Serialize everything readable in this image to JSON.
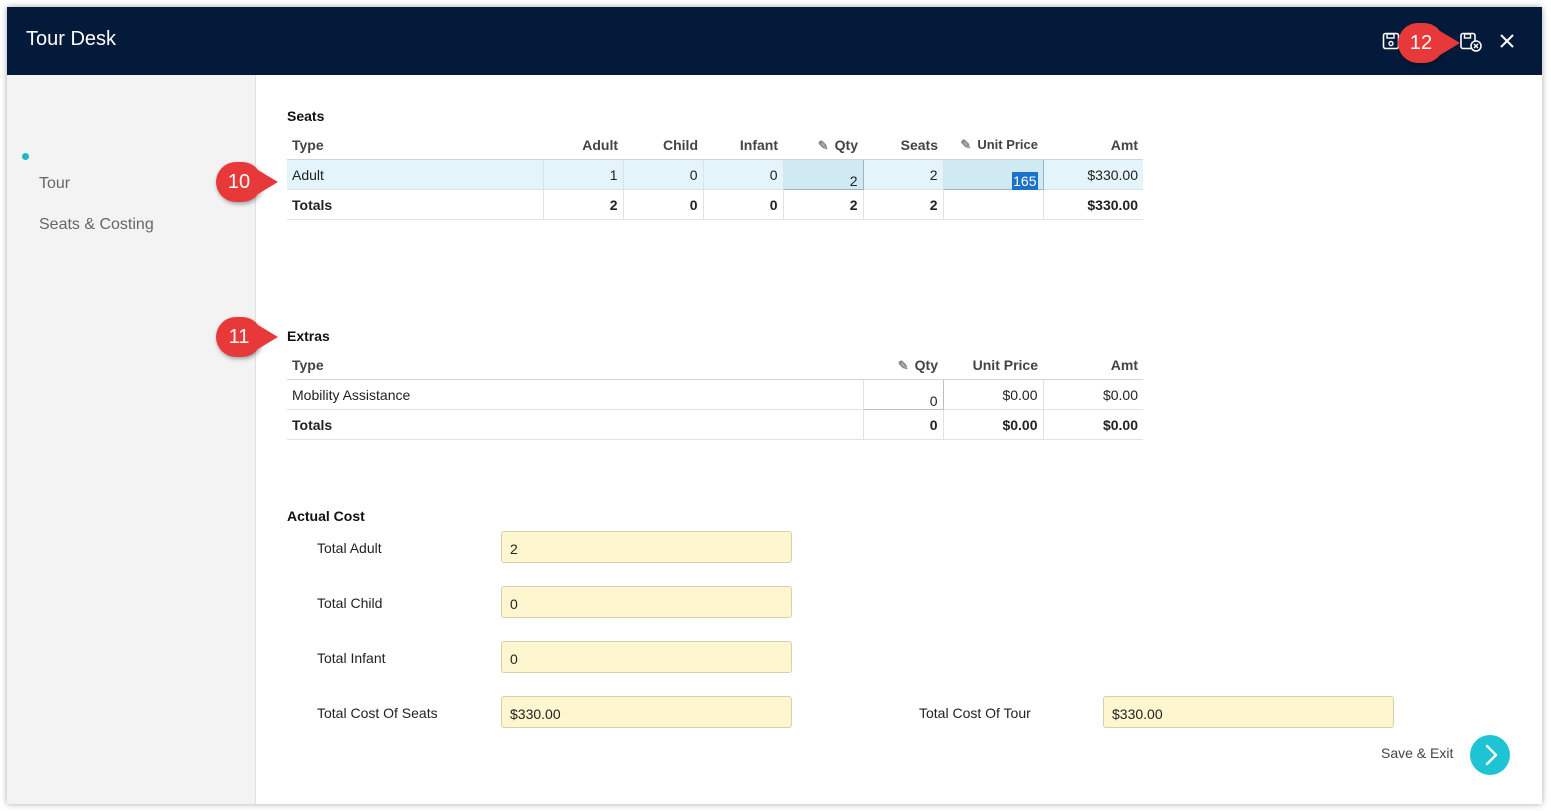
{
  "window": {
    "title": "Tour Desk"
  },
  "sidebar": {
    "items": [
      {
        "label": "Tour"
      },
      {
        "label": "Seats & Costing"
      }
    ]
  },
  "seats": {
    "title": "Seats",
    "columns": [
      "Type",
      "Adult",
      "Child",
      "Infant",
      "Qty",
      "Seats",
      "Unit Price",
      "Amt"
    ],
    "rows": [
      {
        "type": "Adult",
        "adult": "1",
        "child": "0",
        "infant": "0",
        "qty": "2",
        "seats": "2",
        "unit_price": "165",
        "amt": "$330.00"
      }
    ],
    "totals": {
      "label": "Totals",
      "adult": "2",
      "child": "0",
      "infant": "0",
      "qty": "2",
      "seats": "2",
      "unit_price": "",
      "amt": "$330.00"
    }
  },
  "extras": {
    "title": "Extras",
    "columns": [
      "Type",
      "Qty",
      "Unit Price",
      "Amt"
    ],
    "rows": [
      {
        "type": "Mobility Assistance",
        "qty": "0",
        "unit_price": "$0.00",
        "amt": "$0.00"
      }
    ],
    "totals": {
      "label": "Totals",
      "qty": "0",
      "unit_price": "$0.00",
      "amt": "$0.00"
    }
  },
  "actual_cost": {
    "title": "Actual Cost",
    "total_adult": {
      "label": "Total Adult",
      "value": "2"
    },
    "total_child": {
      "label": "Total Child",
      "value": "0"
    },
    "total_infant": {
      "label": "Total Infant",
      "value": "0"
    },
    "total_cost_seats": {
      "label": "Total Cost Of Seats",
      "value": "$330.00"
    },
    "total_cost_tour": {
      "label": "Total Cost Of Tour",
      "value": "$330.00"
    }
  },
  "actions": {
    "save_exit": "Save & Exit"
  },
  "callouts": {
    "c10": "10",
    "c11": "11",
    "c12": "12"
  },
  "colors": {
    "titlebar": "#041a3a",
    "accent": "#1fc4d4",
    "callout": "#e8393a",
    "field_bg": "#fdf6cf"
  }
}
